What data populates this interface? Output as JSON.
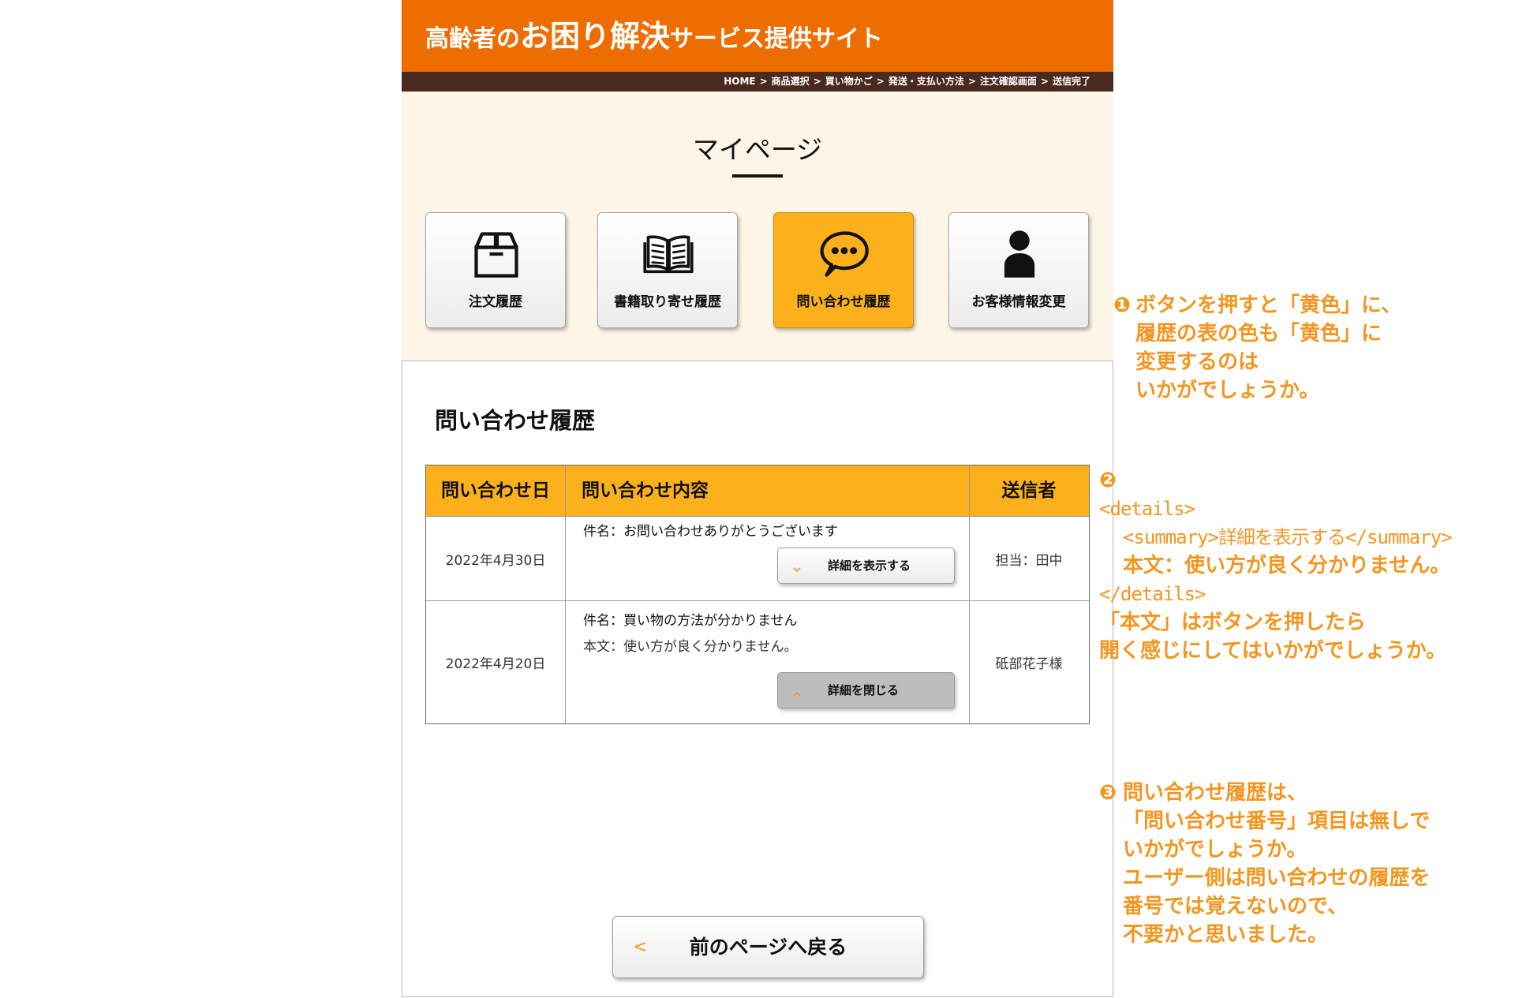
{
  "colors": {
    "header_bg": "#ed6d00",
    "breadcrumb_bg": "#4a2a1f",
    "mypage_bg": "#fdf5e7",
    "accent_yellow": "#fbb01c",
    "annotation": "#f39620"
  },
  "header": {
    "title_pre": "高齢者の",
    "title_main": "お困り解決",
    "title_post": "サービス提供サイト"
  },
  "breadcrumb": {
    "separator": ">",
    "items": [
      "HOME",
      "商品選択",
      "買い物かご",
      "発送・支払い方法",
      "注文確認画面",
      "送信完了"
    ]
  },
  "page_title": "マイページ",
  "menu": {
    "items": [
      {
        "label": "注文履歴",
        "icon": "box-icon",
        "selected": false
      },
      {
        "label": "書籍取り寄せ履歴",
        "icon": "book-icon",
        "selected": false
      },
      {
        "label": "問い合わせ履歴",
        "icon": "chat-bubble-icon",
        "selected": true
      },
      {
        "label": "お客様情報変更",
        "icon": "person-icon",
        "selected": false
      }
    ]
  },
  "section_title": "問い合わせ履歴",
  "inquiries": {
    "headers": {
      "date": "問い合わせ日",
      "content": "問い合わせ内容",
      "sender": "送信者"
    },
    "rows": [
      {
        "date": "2022年4月30日",
        "subject": "件名：お問い合わせありがとうございます",
        "toggle_label": "詳細を表示する",
        "toggle_icon": "chevron-down-icon",
        "expanded": false,
        "sender": "担当：田中"
      },
      {
        "date": "2022年4月20日",
        "subject": "件名：買い物の方法が分かりません",
        "body": "本文：使い方が良く分かりません。",
        "toggle_label": "詳細を閉じる",
        "toggle_icon": "chevron-up-icon",
        "expanded": true,
        "sender": "砥部花子様"
      }
    ]
  },
  "back_button": {
    "arrow": "<",
    "label": "前のページへ戻る"
  },
  "annotations": [
    {
      "marker": "❶",
      "lines": [
        "ボタンを押すと「黄色」に、",
        "履歴の表の色も「黄色」に",
        "変更するのは",
        "いかがでしょうか。"
      ]
    },
    {
      "marker": "❷",
      "lines": [
        "<details>",
        "<summary>詳細を表示する</summary>",
        "本文：使い方が良く分かりません。",
        "</details>",
        "「本文」はボタンを押したら",
        "開く感じにしてはいかがでしょうか。"
      ]
    },
    {
      "marker": "❸",
      "lines": [
        "問い合わせ履歴は、",
        "「問い合わせ番号」項目は無しで",
        "いかがでしょうか。",
        "ユーザー側は問い合わせの履歴を",
        "番号では覚えないので、",
        "不要かと思いました。"
      ]
    }
  ]
}
